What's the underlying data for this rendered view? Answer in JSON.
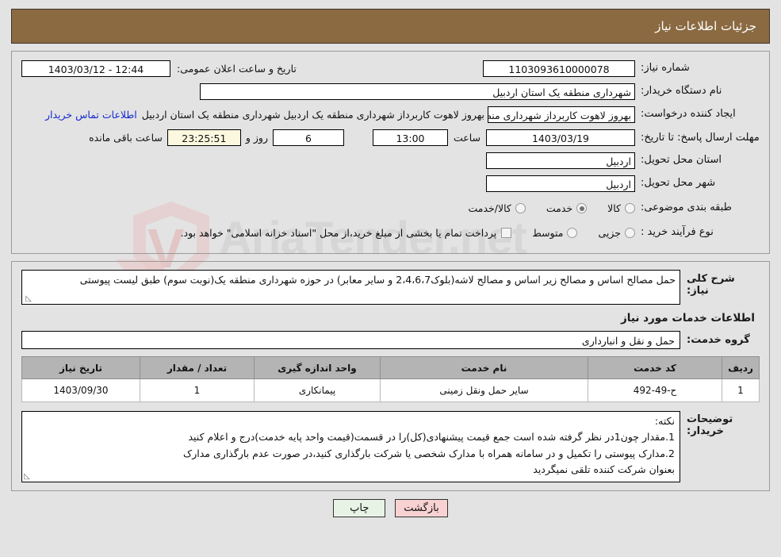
{
  "header": {
    "title": "جزئیات اطلاعات نیاز"
  },
  "need_info": {
    "need_number_label": "شماره نیاز:",
    "need_number": "1103093610000078",
    "buyer_org_label": "نام دستگاه خریدار:",
    "buyer_org": "شهرداری منطقه یک استان اردبیل",
    "requester_label": "ایجاد کننده درخواست:",
    "requester": "بهروز لاهوت کاربرداز شهرداری منطقه یک اردبیل شهرداری منطقه یک استان اردبیل",
    "contact_link": "اطلاعات تماس خریدار",
    "announce_label": "تاریخ و ساعت اعلان عمومی:",
    "announce_datetime": "1403/03/12 - 12:44",
    "deadline_label": "مهلت ارسال پاسخ: تا تاریخ:",
    "deadline_date": "1403/03/19",
    "hour_label": "ساعت",
    "deadline_time": "13:00",
    "days_remaining": "6",
    "days_word": "روز و",
    "countdown": "23:25:51",
    "remaining_suffix": "ساعت باقی مانده",
    "province_label": "استان محل تحویل:",
    "province": "اردبیل",
    "city_label": "شهر محل تحویل:",
    "city": "اردبیل",
    "category_label": "طبقه بندی موضوعی:",
    "category_options": [
      {
        "label": "کالا",
        "checked": false
      },
      {
        "label": "خدمت",
        "checked": true
      },
      {
        "label": "کالا/خدمت",
        "checked": false
      }
    ],
    "process_label": "نوع فرآیند خرید :",
    "process_options": [
      {
        "label": "جزیی",
        "checked": false
      },
      {
        "label": "متوسط",
        "checked": false
      }
    ],
    "treasury_checkbox_checked": false,
    "treasury_note": "پرداخت تمام یا بخشی از مبلغ خرید،از محل \"اسناد خزانه اسلامی\" خواهد بود."
  },
  "description": {
    "label": "شرح کلی نیاز:",
    "text": "حمل مصالح اساس و مصالح زیر اساس و مصالح لاشه(بلوک2،4،6،7 و سایر معابر) در حوزه شهرداری منطقه یک(نوبت سوم) طبق لیست پیوستی"
  },
  "services": {
    "section_title": "اطلاعات خدمات مورد نیاز",
    "group_label": "گروه خدمت:",
    "group_value": "حمل و نقل و انبارداری",
    "columns": [
      "ردیف",
      "کد خدمت",
      "نام خدمت",
      "واحد اندازه گیری",
      "تعداد / مقدار",
      "تاریخ نیاز"
    ],
    "rows": [
      {
        "row": "1",
        "code": "ح-49-492",
        "name": "سایر حمل ونقل زمینی",
        "unit": "پیمانکاری",
        "qty": "1",
        "date": "1403/09/30"
      }
    ]
  },
  "buyer_notes": {
    "label": "توضیحات خریدار:",
    "lines": [
      "نکته:",
      "1.مقدار چون1در نظر گرفته شده است جمع قیمت پیشنهادی(کل)را در قسمت(قیمت واحد پایه خدمت)درج و اعلام کنید",
      "2.مدارک پیوستی را تکمیل و در سامانه همراه با مدارک شخصی یا شرکت بارگذاری کنید،در صورت عدم بارگذاری مدارک",
      "بعنوان شرکت کننده تلقی نمیگردید"
    ]
  },
  "footer": {
    "print_label": "چاپ",
    "back_label": "بازگشت"
  },
  "colors": {
    "header_bg": "#8b6a42",
    "link": "#1229cf",
    "countdown_bg": "#fbf8df",
    "table_header_bg": "#b4b4b4",
    "print_btn_bg": "#e7f4e5",
    "back_btn_bg": "#f8d2d2",
    "page_bg": "#e3e3e3"
  }
}
